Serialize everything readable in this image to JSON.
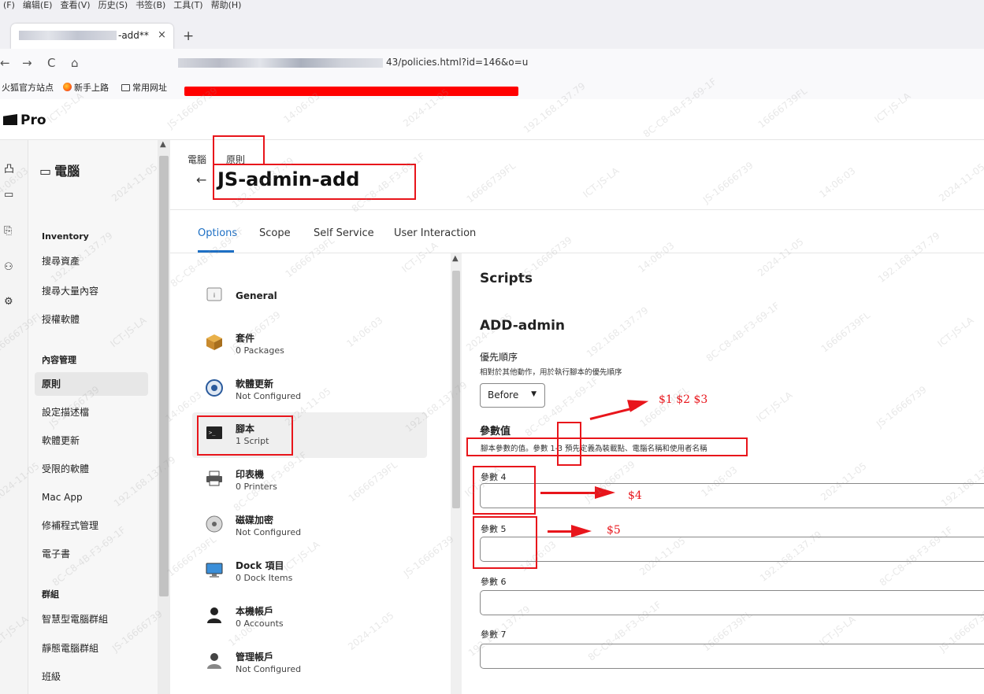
{
  "browser": {
    "menu": [
      "(F)",
      "编辑(E)",
      "查看(V)",
      "历史(S)",
      "书签(B)",
      "工具(T)",
      "帮助(H)"
    ],
    "tab_title": "-add**",
    "tab_close": "×",
    "new_tab": "+",
    "back": "←",
    "forward": "→",
    "reload": "C",
    "home": "⌂",
    "url_visible": "43/policies.html?id=146&o=u",
    "bookmarks": [
      "火狐官方站点",
      "新手上路",
      "常用网址"
    ]
  },
  "app": {
    "logo": "Pro"
  },
  "rail_icons": [
    "dashboard-icon",
    "computer-icon",
    "devices-icon",
    "users-icon",
    "settings-icon"
  ],
  "rail_glyphs": [
    "凸",
    "▭",
    "⎘",
    "⚇",
    "⚙"
  ],
  "sidebar": {
    "section_icon": "▭",
    "section_title": "電腦",
    "inventory_header": "Inventory",
    "inventory_items": [
      "搜尋資產",
      "搜尋大量內容",
      "授權軟體"
    ],
    "content_header": "內容管理",
    "content_items": [
      "原則",
      "設定描述檔",
      "軟體更新",
      "受限的軟體",
      "Mac App",
      "修補程式管理",
      "電子書"
    ],
    "groups_header": "群組",
    "group_items": [
      "智慧型電腦群組",
      "靜態電腦群組",
      "班級"
    ],
    "active_item": "原則"
  },
  "breadcrumb": {
    "parent": "電腦",
    "current": "原則"
  },
  "page_title": "JS-admin-add",
  "tabs": [
    "Options",
    "Scope",
    "Self Service",
    "User Interaction"
  ],
  "active_tab": "Options",
  "payloads": [
    {
      "name": "General",
      "sub": "",
      "icon": "general-icon"
    },
    {
      "name": "套件",
      "sub": "0 Packages",
      "icon": "package-icon"
    },
    {
      "name": "軟體更新",
      "sub": "Not Configured",
      "icon": "software-update-icon"
    },
    {
      "name": "腳本",
      "sub": "1 Script",
      "icon": "script-terminal-icon"
    },
    {
      "name": "印表機",
      "sub": "0 Printers",
      "icon": "printer-icon"
    },
    {
      "name": "磁碟加密",
      "sub": "Not Configured",
      "icon": "disk-encryption-icon"
    },
    {
      "name": "Dock 項目",
      "sub": "0 Dock Items",
      "icon": "dock-icon"
    },
    {
      "name": "本機帳戶",
      "sub": "0 Accounts",
      "icon": "local-account-icon"
    },
    {
      "name": "管理帳戶",
      "sub": "Not Configured",
      "icon": "management-account-icon"
    }
  ],
  "active_payload": "腳本",
  "form": {
    "section_title": "Scripts",
    "script_name": "ADD-admin",
    "priority_label": "優先順序",
    "priority_desc": "相對於其他動作，用於執行腳本的優先順序",
    "priority_value": "Before",
    "params_label": "參數值",
    "params_desc": "腳本參數的值。參數 1-3 預先定義為裝載點、電腦名稱和使用者名稱",
    "param_fields": [
      {
        "label": "參數 4",
        "value": ""
      },
      {
        "label": "參數 5",
        "value": ""
      },
      {
        "label": "參數 6",
        "value": ""
      },
      {
        "label": "參數 7",
        "value": ""
      }
    ]
  },
  "annotations": {
    "params_1_3": "$1 $2 $3",
    "param_4": "$4",
    "param_5": "$5",
    "color": "#e8151b"
  },
  "watermark": {
    "texts": [
      "ICT-JS-LA",
      "JS-16666739",
      "14:06:03",
      "2024-11-05",
      "192.168.137.79",
      "8C-C8-4B-F3-69-1F",
      "16666739FL"
    ]
  },
  "colors": {
    "accent_blue": "#1d6fc4",
    "annotation_red": "#e8151b"
  }
}
